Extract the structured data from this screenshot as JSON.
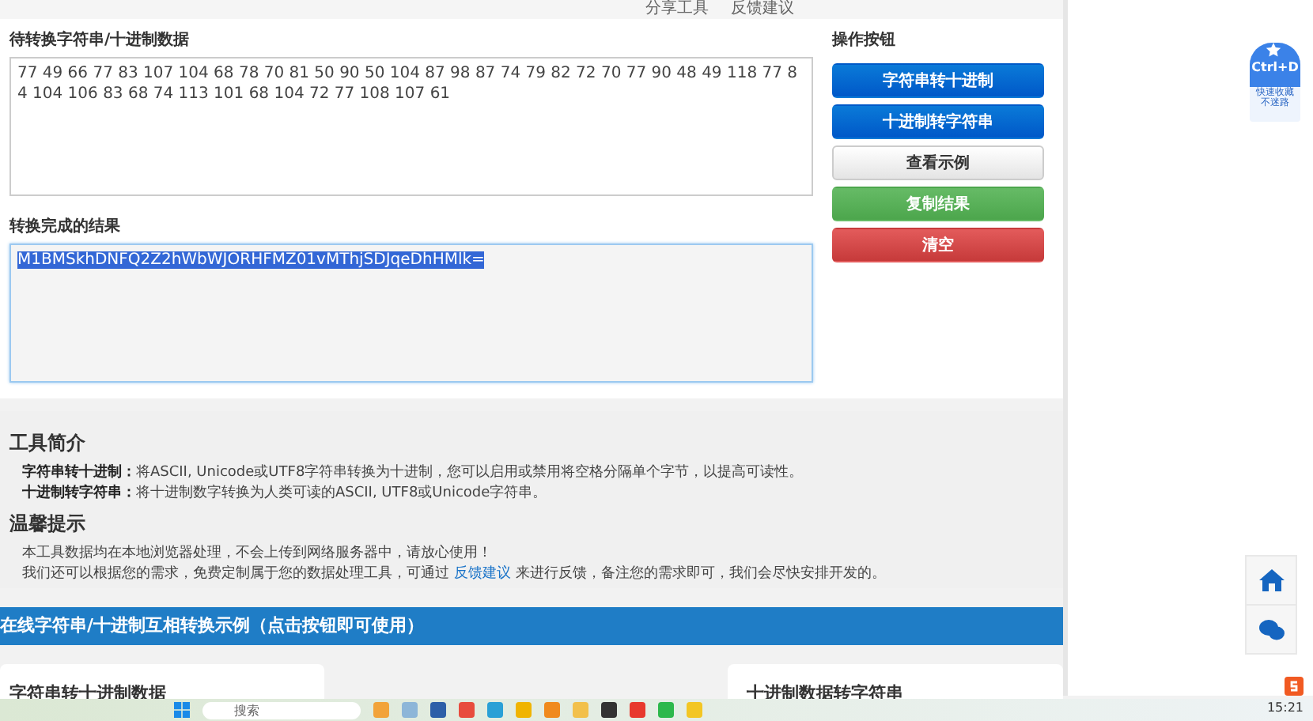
{
  "top_links": [
    "分享工具",
    "反馈建议"
  ],
  "input_section": {
    "label": "待转换字符串/十进制数据",
    "value": "77 49 66 77 83 107 104 68 78 70 81 50 90 50 104 87 98 87 74 79 82 72 70 77 90 48 49 118 77 84 104 106 83 68 74 113 101 68 104 72 77 108 107 61"
  },
  "result_section": {
    "label": "转换完成的结果",
    "value": "M1BMSkhDNFQ2Z2hWbWJORHFMZ01vMThjSDJqeDhHMlk=",
    "selected": true
  },
  "actions": {
    "title": "操作按钮",
    "buttons": [
      {
        "label": "字符串转十进制",
        "kind": "primary"
      },
      {
        "label": "十进制转字符串",
        "kind": "primary"
      },
      {
        "label": "查看示例",
        "kind": "default"
      },
      {
        "label": "复制结果",
        "kind": "success"
      },
      {
        "label": "清空",
        "kind": "danger"
      }
    ]
  },
  "intro": {
    "title": "工具简介",
    "items": [
      {
        "term": "字符串转十进制：",
        "text": "将ASCII, Unicode或UTF8字符串转换为十进制，您可以启用或禁用将空格分隔单个字节，以提高可读性。"
      },
      {
        "term": "十进制转字符串：",
        "text": "将十进制数字转换为人类可读的ASCII, UTF8或Unicode字符串。"
      }
    ]
  },
  "tips": {
    "title": "温馨提示",
    "paragraphs": [
      "本工具数据均在本地浏览器处理，不会上传到网络服务器中，请放心使用！"
    ],
    "feedback": {
      "before": "我们还可以根据您的需求，免费定制属于您的数据处理工具，可通过",
      "link": "反馈建议",
      "after": "来进行反馈，备注您的需求即可，我们会尽快安排开发的。"
    }
  },
  "examples_banner": "在线字符串/十进制互相转换示例（点击按钮即可使用）",
  "example_cards": [
    "字符串转十进制数据",
    "十进制数据转字符串"
  ],
  "bookmark_widget": {
    "key": "Ctrl+D",
    "caption": [
      "快速收藏",
      "不迷路"
    ]
  },
  "taskbar": {
    "search_placeholder": "搜索",
    "time": "15:21"
  }
}
